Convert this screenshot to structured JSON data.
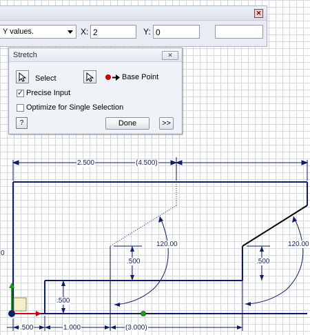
{
  "toolbar": {
    "mode_value": "Y values.",
    "x_label": "X:",
    "x_value": "2",
    "y_label": "Y:",
    "y_value": "0",
    "extra_value": "",
    "close_glyph": "✕"
  },
  "dialog": {
    "title": "Stretch",
    "close_glyph": "✕",
    "select_label": "Select",
    "base_point_label": "Base Point",
    "precise_input_label": "Precise Input",
    "precise_input_checked": true,
    "optimize_label": "Optimize for Single Selection",
    "optimize_checked": false,
    "help_glyph": "?",
    "done_label": "Done",
    "more_label": ">>"
  },
  "dimensions": {
    "top_left": "2.500",
    "top_right": "(4.500)",
    "angle_left": "120.00",
    "angle_right": "120.00",
    "height_left": ".500",
    "height_right": ".500",
    "base_height": ".500",
    "bottom_a": ".500",
    "bottom_b": "1.000",
    "bottom_c": "(3.000)",
    "left_edge": "0"
  },
  "colors": {
    "sketch_line": "#0b1e66",
    "grid": "#d4d8de",
    "x_axis": "#d40000",
    "y_axis": "#16a016",
    "origin": "#0b1e66",
    "center_point": "#1e9e1e"
  }
}
